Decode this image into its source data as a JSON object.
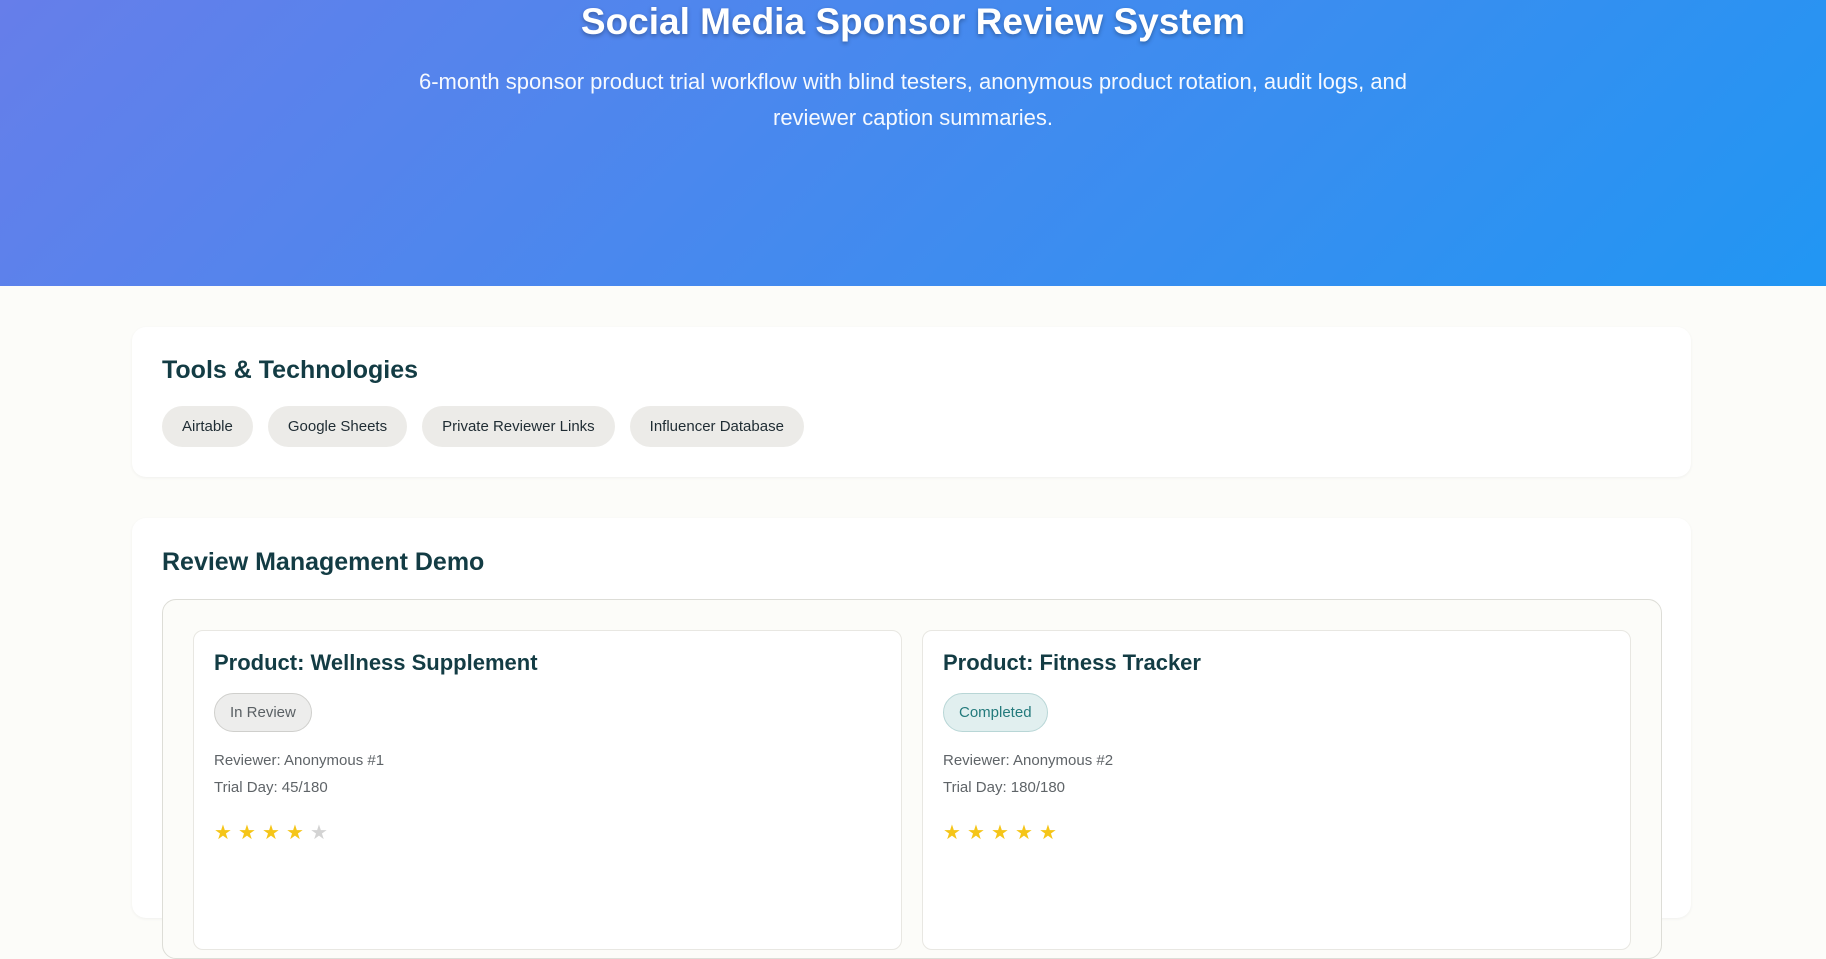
{
  "hero": {
    "title": "Social Media Sponsor Review System",
    "subtitle": "6-month sponsor product trial workflow with blind testers, anonymous product rotation, audit logs, and reviewer caption summaries."
  },
  "tools": {
    "title": "Tools & Technologies",
    "tags": [
      "Airtable",
      "Google Sheets",
      "Private Reviewer Links",
      "Influencer Database"
    ]
  },
  "demo": {
    "title": "Review Management Demo",
    "products": [
      {
        "title": "Product: Wellness Supplement",
        "status": "In Review",
        "reviewer": "Reviewer: Anonymous #1",
        "trial_day": "Trial Day: 45/180",
        "rating": 4,
        "rating_max": 5
      },
      {
        "title": "Product: Fitness Tracker",
        "status": "Completed",
        "reviewer": "Reviewer: Anonymous #2",
        "trial_day": "Trial Day: 180/180",
        "rating": 5,
        "rating_max": 5
      }
    ]
  },
  "colors": {
    "gradient_start": "#667eea",
    "gradient_end": "#2196f3",
    "heading": "#133c44",
    "star": "#f5c518",
    "completed": "#237a7c"
  },
  "icons": {
    "star_filled": "star-filled-icon",
    "star_empty": "star-empty-icon"
  }
}
